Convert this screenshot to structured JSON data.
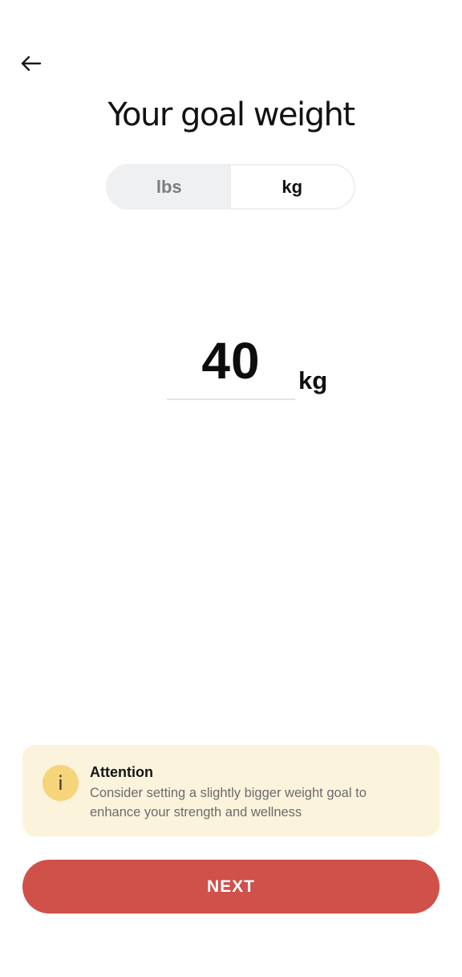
{
  "header": {
    "back_icon": "arrow-left-icon",
    "title": "Your goal weight"
  },
  "unit_toggle": {
    "options": [
      "lbs",
      "kg"
    ],
    "selected": "kg"
  },
  "weight": {
    "value": "40",
    "unit": "kg"
  },
  "attention": {
    "icon": "info-icon",
    "icon_glyph": "i",
    "title": "Attention",
    "text": "Consider setting a slightly bigger weight goal to enhance your strength and wellness"
  },
  "footer": {
    "next_label": "NEXT"
  },
  "colors": {
    "accent": "#d0504a",
    "attention_bg": "#fcf3dd",
    "attention_icon_bg": "#f6d47a",
    "toggle_inactive_bg": "#eff0f2"
  }
}
